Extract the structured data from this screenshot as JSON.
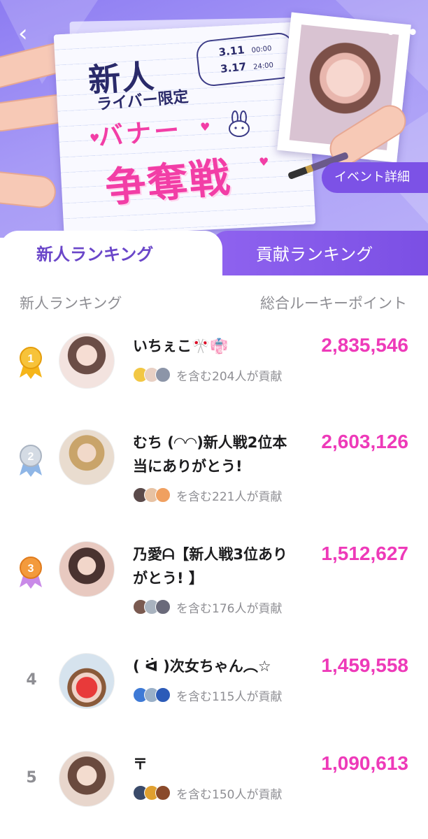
{
  "banner": {
    "title_newbie": "新人",
    "title_limited": "ライバー限定",
    "title_banner": "バナー",
    "title_battle": "争奪戦",
    "date_start": "3.11",
    "date_start_time": "00:00",
    "date_end": "3.17",
    "date_end_time": "24:00",
    "event_button": "イベント詳細"
  },
  "tabs": [
    {
      "label": "新人ランキング",
      "active": true
    },
    {
      "label": "貢献ランキング",
      "active": false
    }
  ],
  "list_header": {
    "left": "新人ランキング",
    "right": "総合ルーキーポイント"
  },
  "rankings": [
    {
      "rank": "1",
      "name": "いちぇこ🎌👘",
      "points": "2,835,546",
      "contrib": "を含む204人が貢献",
      "medal": "gold",
      "avatar_colors": [
        "#f3e3df",
        "#6b4d46"
      ],
      "mini_colors": [
        "#f2c744",
        "#e8d0c4",
        "#8c95a8"
      ]
    },
    {
      "rank": "2",
      "name": "むち (◠◠)新人戦2位本当にありがとう!",
      "points": "2,603,126",
      "contrib": "を含む221人が貢献",
      "medal": "silver",
      "avatar_colors": [
        "#e9dccf",
        "#c9a46a"
      ],
      "mini_colors": [
        "#5a4a4a",
        "#e7c2a3",
        "#f0a060"
      ]
    },
    {
      "rank": "3",
      "name": "乃愛ᗩ【新人戦3位ありがとう! 】",
      "points": "1,512,627",
      "contrib": "を含む176人が貢献",
      "medal": "bronze",
      "avatar_colors": [
        "#e8c9c0",
        "#4a3330"
      ],
      "mini_colors": [
        "#7a5a50",
        "#a9b3bf",
        "#6a6a7a"
      ]
    },
    {
      "rank": "4",
      "name": "( ᐛ )次女ちゃん︵☆",
      "points": "1,459,558",
      "contrib": "を含む115人が貢献",
      "medal": "",
      "avatar_colors": [
        "#d6e3ee",
        "#e83a3a"
      ],
      "mini_colors": [
        "#3e7ad6",
        "#9ab0c8",
        "#2c5bb8"
      ]
    },
    {
      "rank": "5",
      "name": "〒",
      "points": "1,090,613",
      "contrib": "を含む150人が貢献",
      "medal": "",
      "avatar_colors": [
        "#e8d6cc",
        "#6a4a3e"
      ],
      "mini_colors": [
        "#3a4a6a",
        "#e0a030",
        "#8a4a2a"
      ]
    }
  ]
}
